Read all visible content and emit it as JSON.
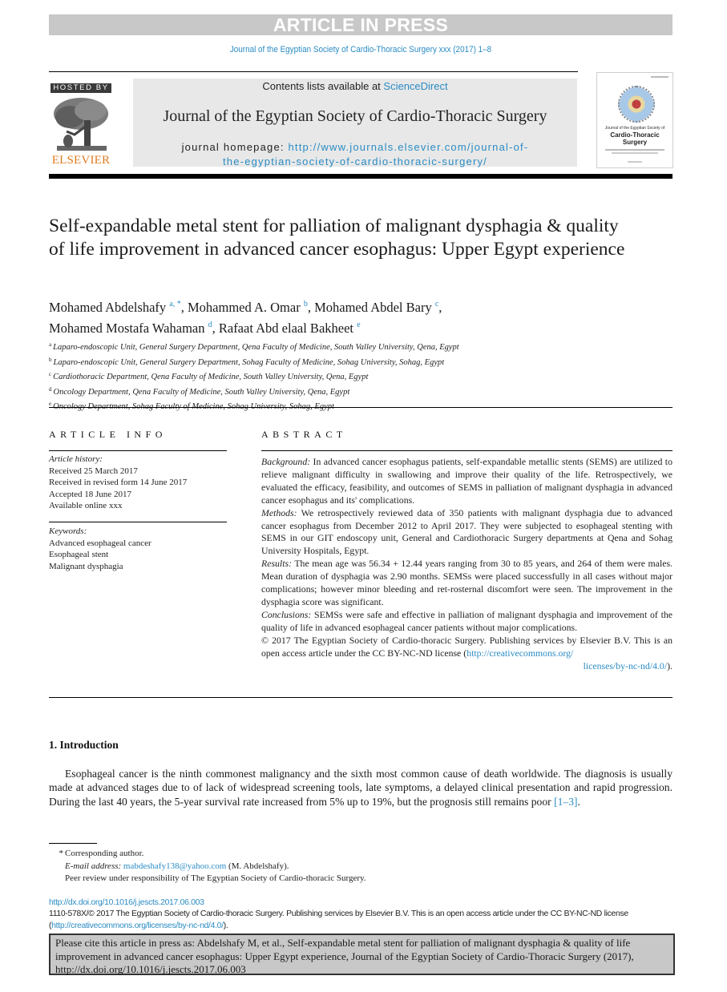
{
  "banner": {
    "label": "ARTICLE IN PRESS"
  },
  "running_header": "Journal of the Egyptian Society of Cardio-Thoracic Surgery xxx (2017) 1–8",
  "masthead": {
    "hosted_by": "HOSTED BY",
    "publisher_logo_text": "ELSEVIER",
    "contents_prefix": "Contents lists available at ",
    "contents_link": "ScienceDirect",
    "journal_title": "Journal of the Egyptian Society of Cardio-Thoracic Surgery",
    "homepage_prefix": "journal homepage: ",
    "homepage_url_line1": "http://www.journals.elsevier.com/journal-of-",
    "homepage_url_line2": "the-egyptian-society-of-cardio-thoracic-surgery/",
    "cover": {
      "line1": "Journal of the Egyptian Society of",
      "line2": "Cardio-Thoracic",
      "line3": "Surgery"
    }
  },
  "article": {
    "title": "Self-expandable metal stent for palliation of malignant dysphagia & quality of life improvement in advanced cancer esophagus: Upper Egypt experience",
    "authors": [
      {
        "name": "Mohamed Abdelshafy",
        "sup": "a, *",
        "sep": ", "
      },
      {
        "name": "Mohammed A. Omar",
        "sup": "b",
        "sep": ", "
      },
      {
        "name": "Mohamed Abdel Bary",
        "sup": "c",
        "sep": ","
      },
      {
        "name": "Mohamed Mostafa Wahaman",
        "sup": "d",
        "sep": ", "
      },
      {
        "name": "Rafaat Abd elaal Bakheet",
        "sup": "e",
        "sep": ""
      }
    ],
    "affiliations": [
      {
        "key": "a",
        "text": "Laparo-endoscopic Unit, General Surgery Department, Qena Faculty of Medicine, South Valley University, Qena, Egypt"
      },
      {
        "key": "b",
        "text": "Laparo-endoscopic Unit, General Surgery Department, Sohag Faculty of Medicine, Sohag University, Sohag, Egypt"
      },
      {
        "key": "c",
        "text": "Cardiothoracic Department, Qena Faculty of Medicine, South Valley University, Qena, Egypt"
      },
      {
        "key": "d",
        "text": "Oncology Department, Qena Faculty of Medicine, South Valley University, Qena, Egypt"
      },
      {
        "key": "e",
        "text": "Oncology Department, Sohag Faculty of Medicine, Sohag University, Sohag, Egypt"
      }
    ]
  },
  "article_info": {
    "heading": "ARTICLE INFO",
    "history_label": "Article history:",
    "history": [
      "Received 25 March 2017",
      "Received in revised form 14 June 2017",
      "Accepted 18 June 2017",
      "Available online xxx"
    ],
    "keywords_label": "Keywords:",
    "keywords": [
      "Advanced esophageal cancer",
      "Esophageal stent",
      "Malignant dysphagia"
    ]
  },
  "abstract": {
    "heading": "ABSTRACT",
    "sections": [
      {
        "label": "Background:",
        "text": " In advanced cancer esophagus patients, self-expandable metallic stents (SEMS) are utilized to relieve malignant difficulty in swallowing and improve their quality of the life. Retrospectively, we evaluated the efficacy, feasibility, and outcomes of SEMS in palliation of malignant dysphagia in advanced cancer esophagus and its' complications."
      },
      {
        "label": "Methods:",
        "text": " We retrospectively reviewed data of 350 patients with malignant dysphagia due to advanced cancer esophagus from December 2012 to April 2017. They were subjected to esophageal stenting with SEMS in our GIT endoscopy unit, General and Cardiothoracic Surgery departments at Qena and Sohag University Hospitals, Egypt."
      },
      {
        "label": "Results:",
        "text": " The mean age was 56.34 + 12.44 years ranging from 30 to 85 years, and 264 of them were males. Mean duration of dysphagia was 2.90 months. SEMSs were placed successfully in all cases without major complications; however minor bleeding and ret-rosternal discomfort were seen. The improvement in the dysphagia score was significant."
      },
      {
        "label": "Conclusions:",
        "text": " SEMSs were safe and effective in palliation of malignant dysphagia and improvement of the quality of life in advanced esophageal cancer patients without major complications."
      }
    ],
    "copyright": "© 2017 The Egyptian Society of Cardio-thoracic Surgery. Publishing services by Elsevier B.V. This is an open access article under the CC BY-NC-ND license (",
    "license_url_part1": "http://creativecommons.org/",
    "license_url_part2": "licenses/by-nc-nd/4.0/",
    "license_close": ")."
  },
  "introduction": {
    "heading": "1.  Introduction",
    "paragraph": "Esophageal cancer is the ninth commonest malignancy and the sixth most common cause of death worldwide. The diagnosis is usually made at advanced stages due to of lack of widespread screening tools, late symptoms, a delayed clinical presentation and rapid progression. During the last 40 years, the 5-year survival rate increased from 5% up to 19%, but the prognosis still remains poor ",
    "citation": "[1–3]",
    "end": "."
  },
  "footnotes": {
    "star": "*",
    "corresponding": "Corresponding author.",
    "email_label": "E-mail address:",
    "email": "mabdeshafy138@yahoo.com",
    "email_owner": " (M. Abdelshafy).",
    "peer_review": "Peer review under responsibility of The Egyptian Society of Cardio-thoracic Surgery."
  },
  "doi_block": {
    "doi_url": "http://dx.doi.org/10.1016/j.jescts.2017.06.003",
    "issn_line": "1110-578X/© 2017 The Egyptian Society of Cardio-thoracic Surgery. Publishing services by Elsevier B.V. This is an open access article under the CC BY-NC-ND license (",
    "license_url": "http://creativecommons.org/licenses/by-nc-nd/4.0/",
    "license_close": ")."
  },
  "cite_box": {
    "text": "Please cite this article in press as: Abdelshafy M, et al., Self-expandable metal stent for palliation of malignant dysphagia & quality of life improvement in advanced cancer esophagus: Upper Egypt experience, Journal of the Egyptian Society of Cardio-Thoracic Surgery (2017), http://dx.doi.org/10.1016/j.jescts.2017.06.003"
  },
  "colors": {
    "link": "#2b8cc4",
    "banner_bg": "#c8c8c8",
    "masthead_bg": "#e8e8e8",
    "elsevier_orange": "#e07b1f"
  }
}
